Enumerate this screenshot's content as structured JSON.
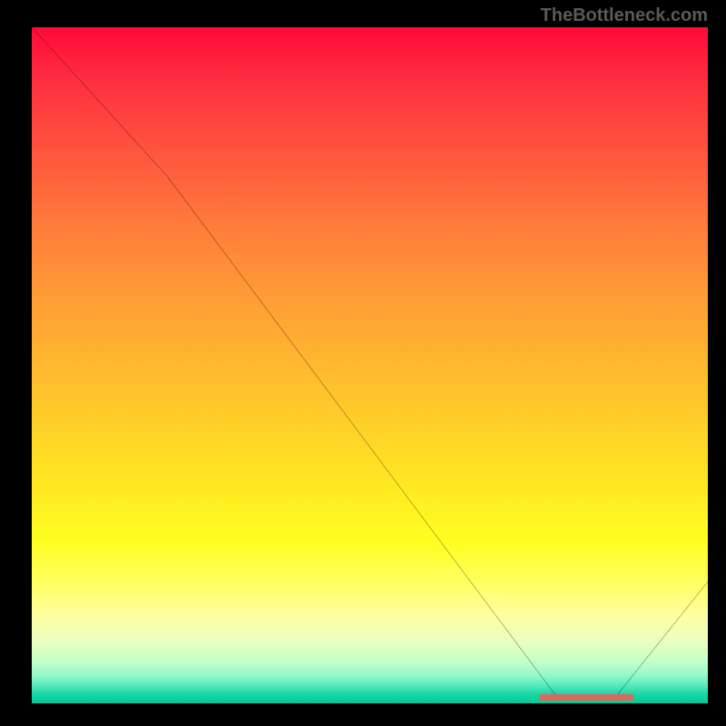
{
  "watermark_text": "TheBottleneck.com",
  "chart_data": {
    "type": "line",
    "title": "",
    "xlabel": "",
    "ylabel": "",
    "xlim": [
      0,
      100
    ],
    "ylim": [
      0,
      100
    ],
    "grid": false,
    "legend": false,
    "background": "red-yellow-green vertical gradient",
    "series": [
      {
        "name": "bottleneck-curve",
        "color": "#000000",
        "x": [
          0,
          20,
          78,
          86,
          100
        ],
        "y": [
          100,
          78,
          0.5,
          0.5,
          18
        ]
      }
    ],
    "annotations": [
      {
        "name": "optimal-range-marker",
        "type": "bar-segment",
        "color": "#d86a5a",
        "x_start": 75,
        "x_end": 89,
        "y": 0.9,
        "height_pct": 1.0
      }
    ]
  }
}
